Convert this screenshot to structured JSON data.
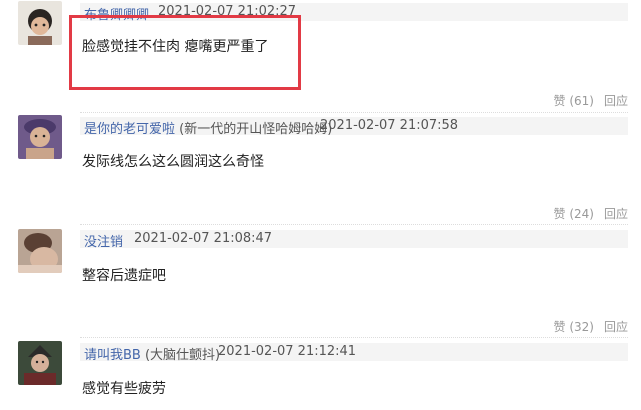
{
  "comments": [
    {
      "username": "布鲁卿卿卿",
      "tag": "",
      "time": "2021-02-07 21:02:27",
      "text": "脸感觉挂不住肉 瘪嘴更严重了",
      "like_label": "赞",
      "like_count": "(61)",
      "reply_label": "回应"
    },
    {
      "username": "是你的老可爱啦",
      "tag": "(新一代的开山怪哈姆哈姆)",
      "time": "2021-02-07 21:07:58",
      "text": "发际线怎么这么圆润这么奇怪",
      "like_label": "赞",
      "like_count": "(24)",
      "reply_label": "回应"
    },
    {
      "username": "没注销",
      "tag": "",
      "time": "2021-02-07 21:08:47",
      "text": "整容后遗症吧",
      "like_label": "赞",
      "like_count": "(32)",
      "reply_label": "回应"
    },
    {
      "username": "请叫我BB",
      "tag": "(大脑仕颤抖)",
      "time": "2021-02-07 21:12:41",
      "text": "感觉有些疲劳",
      "like_label": "",
      "like_count": "",
      "reply_label": ""
    }
  ],
  "colors": {
    "highlight_box": "#e23a45",
    "username_link": "#4466aa",
    "header_bar": "#f4f4f4"
  }
}
